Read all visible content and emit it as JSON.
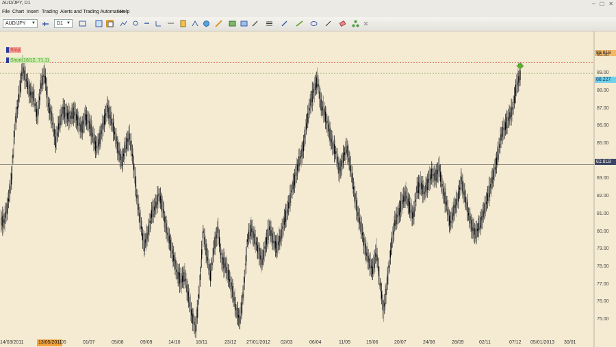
{
  "window": {
    "title": "AUD/JPY, D1"
  },
  "menu": [
    "File",
    "Chart",
    "Insert",
    "Trading",
    "Alerts and Trading Automation",
    "Help"
  ],
  "toolbar": {
    "symbol": "AUD/JPY",
    "timeframe": "D1"
  },
  "chart_data": {
    "type": "candlestick",
    "symbol": "AUD/JPY",
    "timeframe": "D1",
    "y_ticks": [
      "90.00",
      "89.00",
      "88.00",
      "87.00",
      "86.00",
      "85.00",
      "84.00",
      "83.00",
      "82.00",
      "81.00",
      "80.00",
      "79.00",
      "78.00",
      "77.00",
      "76.00",
      "75.00"
    ],
    "ylim": [
      74.5,
      90.6
    ],
    "x_ticks": [
      "14/03/2011",
      "13/05/2011",
      "05",
      "01/07",
      "05/08",
      "09/09",
      "14/10",
      "18/11",
      "23/12",
      "27/01/2012",
      "02/03",
      "06/04",
      "11/05",
      "15/06",
      "20/07",
      "24/08",
      "28/09",
      "02/11",
      "07/12",
      "05/01/2013",
      "30/01"
    ],
    "x_highlight": "13/05/2011",
    "last_price": "88.227",
    "crosshair_price": "83.818",
    "stop": {
      "label": "Stop",
      "price": "89.619"
    },
    "short": {
      "label": "Short(16/12, 71.1)",
      "price": 89.0
    },
    "close_series": [
      80.6,
      81.5,
      83.0,
      86.2,
      87.6,
      89.3,
      88.6,
      87.9,
      87.7,
      86.5,
      88.3,
      89.0,
      87.2,
      86.4,
      85.1,
      86.2,
      86.9,
      86.6,
      86.5,
      86.8,
      86.3,
      85.8,
      86.5,
      86.2,
      85.5,
      84.7,
      85.3,
      86.2,
      87.0,
      86.4,
      85.6,
      84.6,
      84.0,
      84.9,
      85.4,
      84.1,
      82.0,
      80.5,
      79.2,
      79.9,
      81.0,
      81.4,
      82.1,
      81.4,
      80.2,
      79.4,
      78.5,
      77.6,
      77.2,
      77.5,
      76.3,
      75.2,
      74.5,
      76.8,
      80.0,
      78.7,
      77.5,
      79.2,
      80.1,
      78.4,
      78.1,
      77.4,
      76.6,
      75.5,
      75.0,
      76.7,
      79.5,
      80.2,
      79.6,
      78.9,
      78.3,
      79.3,
      80.2,
      79.5,
      79.1,
      79.7,
      80.6,
      81.3,
      82.3,
      83.1,
      84.0,
      84.6,
      86.0,
      87.2,
      88.0,
      88.6,
      87.2,
      86.7,
      85.9,
      85.0,
      84.5,
      83.4,
      84.2,
      84.8,
      83.6,
      82.2,
      81.0,
      80.1,
      79.0,
      78.3,
      77.8,
      78.9,
      77.0,
      75.5,
      77.3,
      79.1,
      80.5,
      81.0,
      81.7,
      82.1,
      81.4,
      80.8,
      82.4,
      82.7,
      82.2,
      82.8,
      83.3,
      83.1,
      83.6,
      82.4,
      81.6,
      80.4,
      81.2,
      81.8,
      82.9,
      82.0,
      81.0,
      80.2,
      79.9,
      80.4,
      81.0,
      81.8,
      82.6,
      83.4,
      84.4,
      85.6,
      86.0,
      86.5,
      87.0,
      88.3,
      88.9
    ]
  }
}
